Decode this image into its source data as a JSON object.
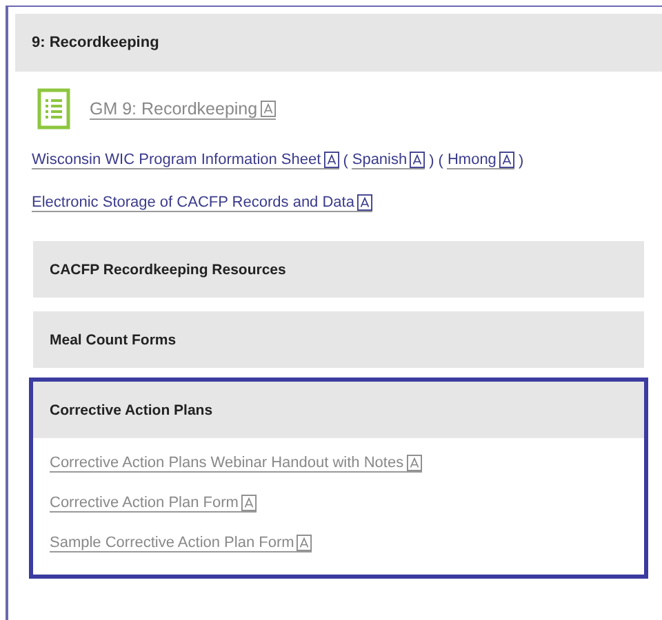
{
  "section": {
    "title": "9: Recordkeeping"
  },
  "guide_link": {
    "label": "GM 9: Recordkeeping",
    "visited": true
  },
  "link_lines": [
    {
      "parts": [
        {
          "kind": "link",
          "text": "Wisconsin WIC Program Information Sheet"
        },
        {
          "kind": "text",
          "text": "("
        },
        {
          "kind": "link",
          "text": "Spanish"
        },
        {
          "kind": "text",
          "text": ")"
        },
        {
          "kind": "text",
          "text": "("
        },
        {
          "kind": "link",
          "text": "Hmong"
        },
        {
          "kind": "text",
          "text": ")"
        }
      ]
    },
    {
      "parts": [
        {
          "kind": "link",
          "text": "Electronic Storage of CACFP Records and Data"
        }
      ]
    }
  ],
  "accordions": [
    {
      "title": "CACFP Recordkeeping Resources",
      "expanded": false,
      "highlighted": false
    },
    {
      "title": "Meal Count Forms",
      "expanded": false,
      "highlighted": false
    },
    {
      "title": "Corrective Action Plans",
      "expanded": true,
      "highlighted": true,
      "links": [
        {
          "label": "Corrective Action Plans Webinar Handout with Notes",
          "visited": true
        },
        {
          "label": "Corrective Action Plan Form",
          "visited": true
        },
        {
          "label": "Sample Corrective Action Plan Form",
          "visited": true
        }
      ]
    }
  ]
}
